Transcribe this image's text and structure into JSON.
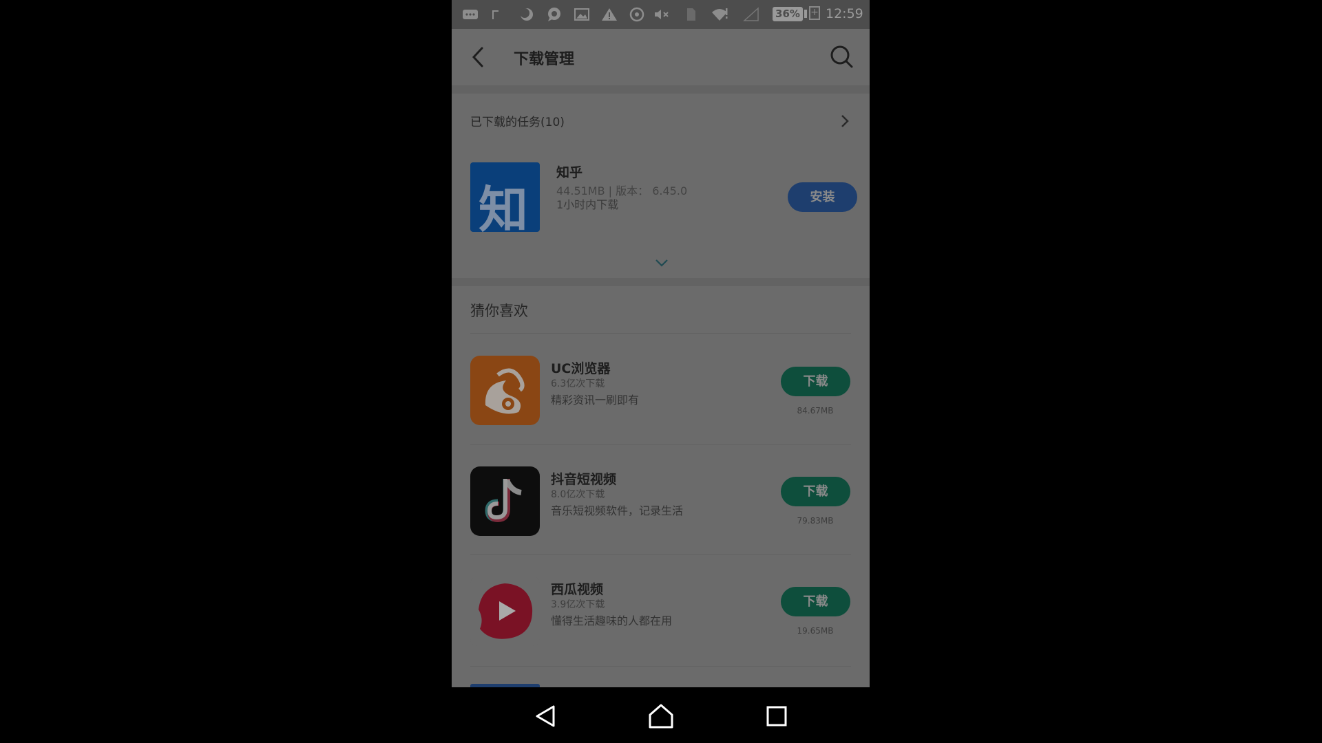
{
  "status_bar": {
    "battery": "36%",
    "battery_plus": "+",
    "time": "12:59",
    "icons": [
      "message-icon",
      "image-icon",
      "moon-icon",
      "chat-icon",
      "picture-icon",
      "warning-icon",
      "settings-icon",
      "mute-icon",
      "sim-icon",
      "wifi-icon",
      "signal-icon"
    ]
  },
  "header": {
    "title": "下载管理"
  },
  "downloaded": {
    "label": "已下载的任务(10)",
    "apps": [
      {
        "name": "知乎",
        "icon_text": "知",
        "meta": "44.51MB | 版本： 6.45.0",
        "time": "1小时内下载",
        "button": "安装",
        "icon_color": "#0a3f7a"
      }
    ]
  },
  "recommend": {
    "title": "猜你喜欢",
    "apps": [
      {
        "name": "UC浏览器",
        "downloads": "6.3亿次下载",
        "desc": "精彩资讯一刷即有",
        "button": "下载",
        "size": "84.67MB",
        "icon_color": "#8a4614"
      },
      {
        "name": "抖音短视频",
        "downloads": "8.0亿次下载",
        "desc": "音乐短视频软件，记录生活",
        "button": "下载",
        "size": "79.83MB",
        "icon_color": "#0d0d0d"
      },
      {
        "name": "西瓜视频",
        "downloads": "3.9亿次下载",
        "desc": "懂得生活趣味的人都在用",
        "button": "下载",
        "size": "19.65MB",
        "icon_color": "#7a1225"
      }
    ]
  }
}
